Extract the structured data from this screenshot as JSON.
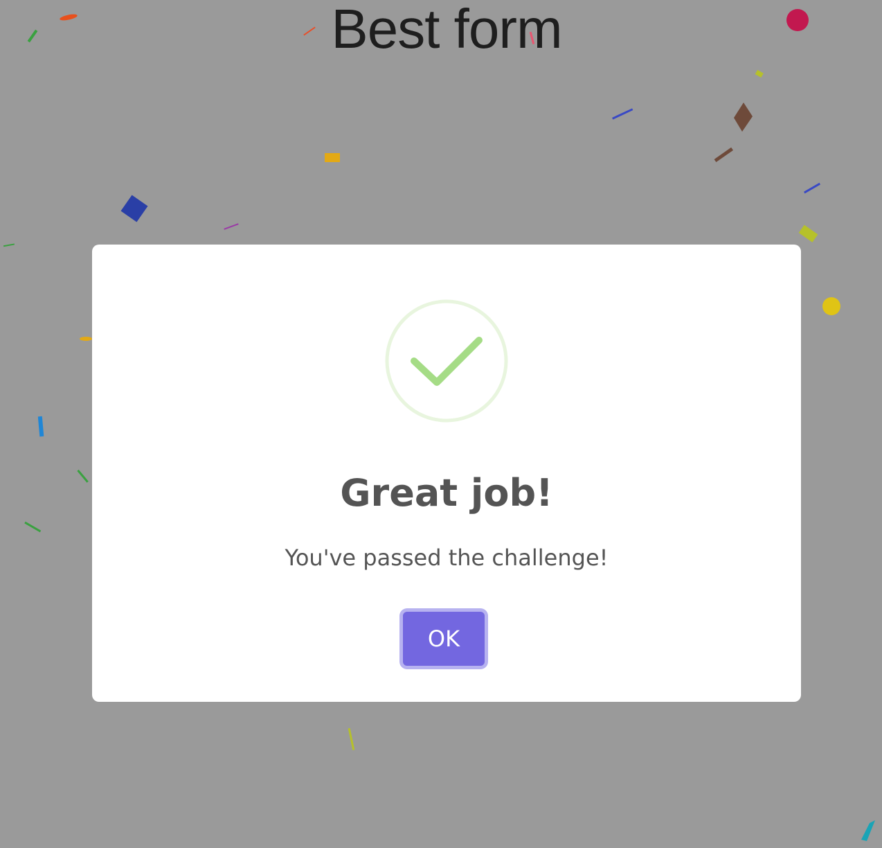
{
  "page": {
    "title": "Best form"
  },
  "modal": {
    "icon": "success-check-icon",
    "title": "Great job!",
    "text": "You've passed the challenge!",
    "ok_label": "OK"
  },
  "colors": {
    "overlay": "#9a9a9a",
    "modal_bg": "#ffffff",
    "text": "#545454",
    "success": "#a5dc86",
    "success_ring": "#e8f5de",
    "button": "#7367e0",
    "button_focus_ring": "#b7b2f0"
  }
}
